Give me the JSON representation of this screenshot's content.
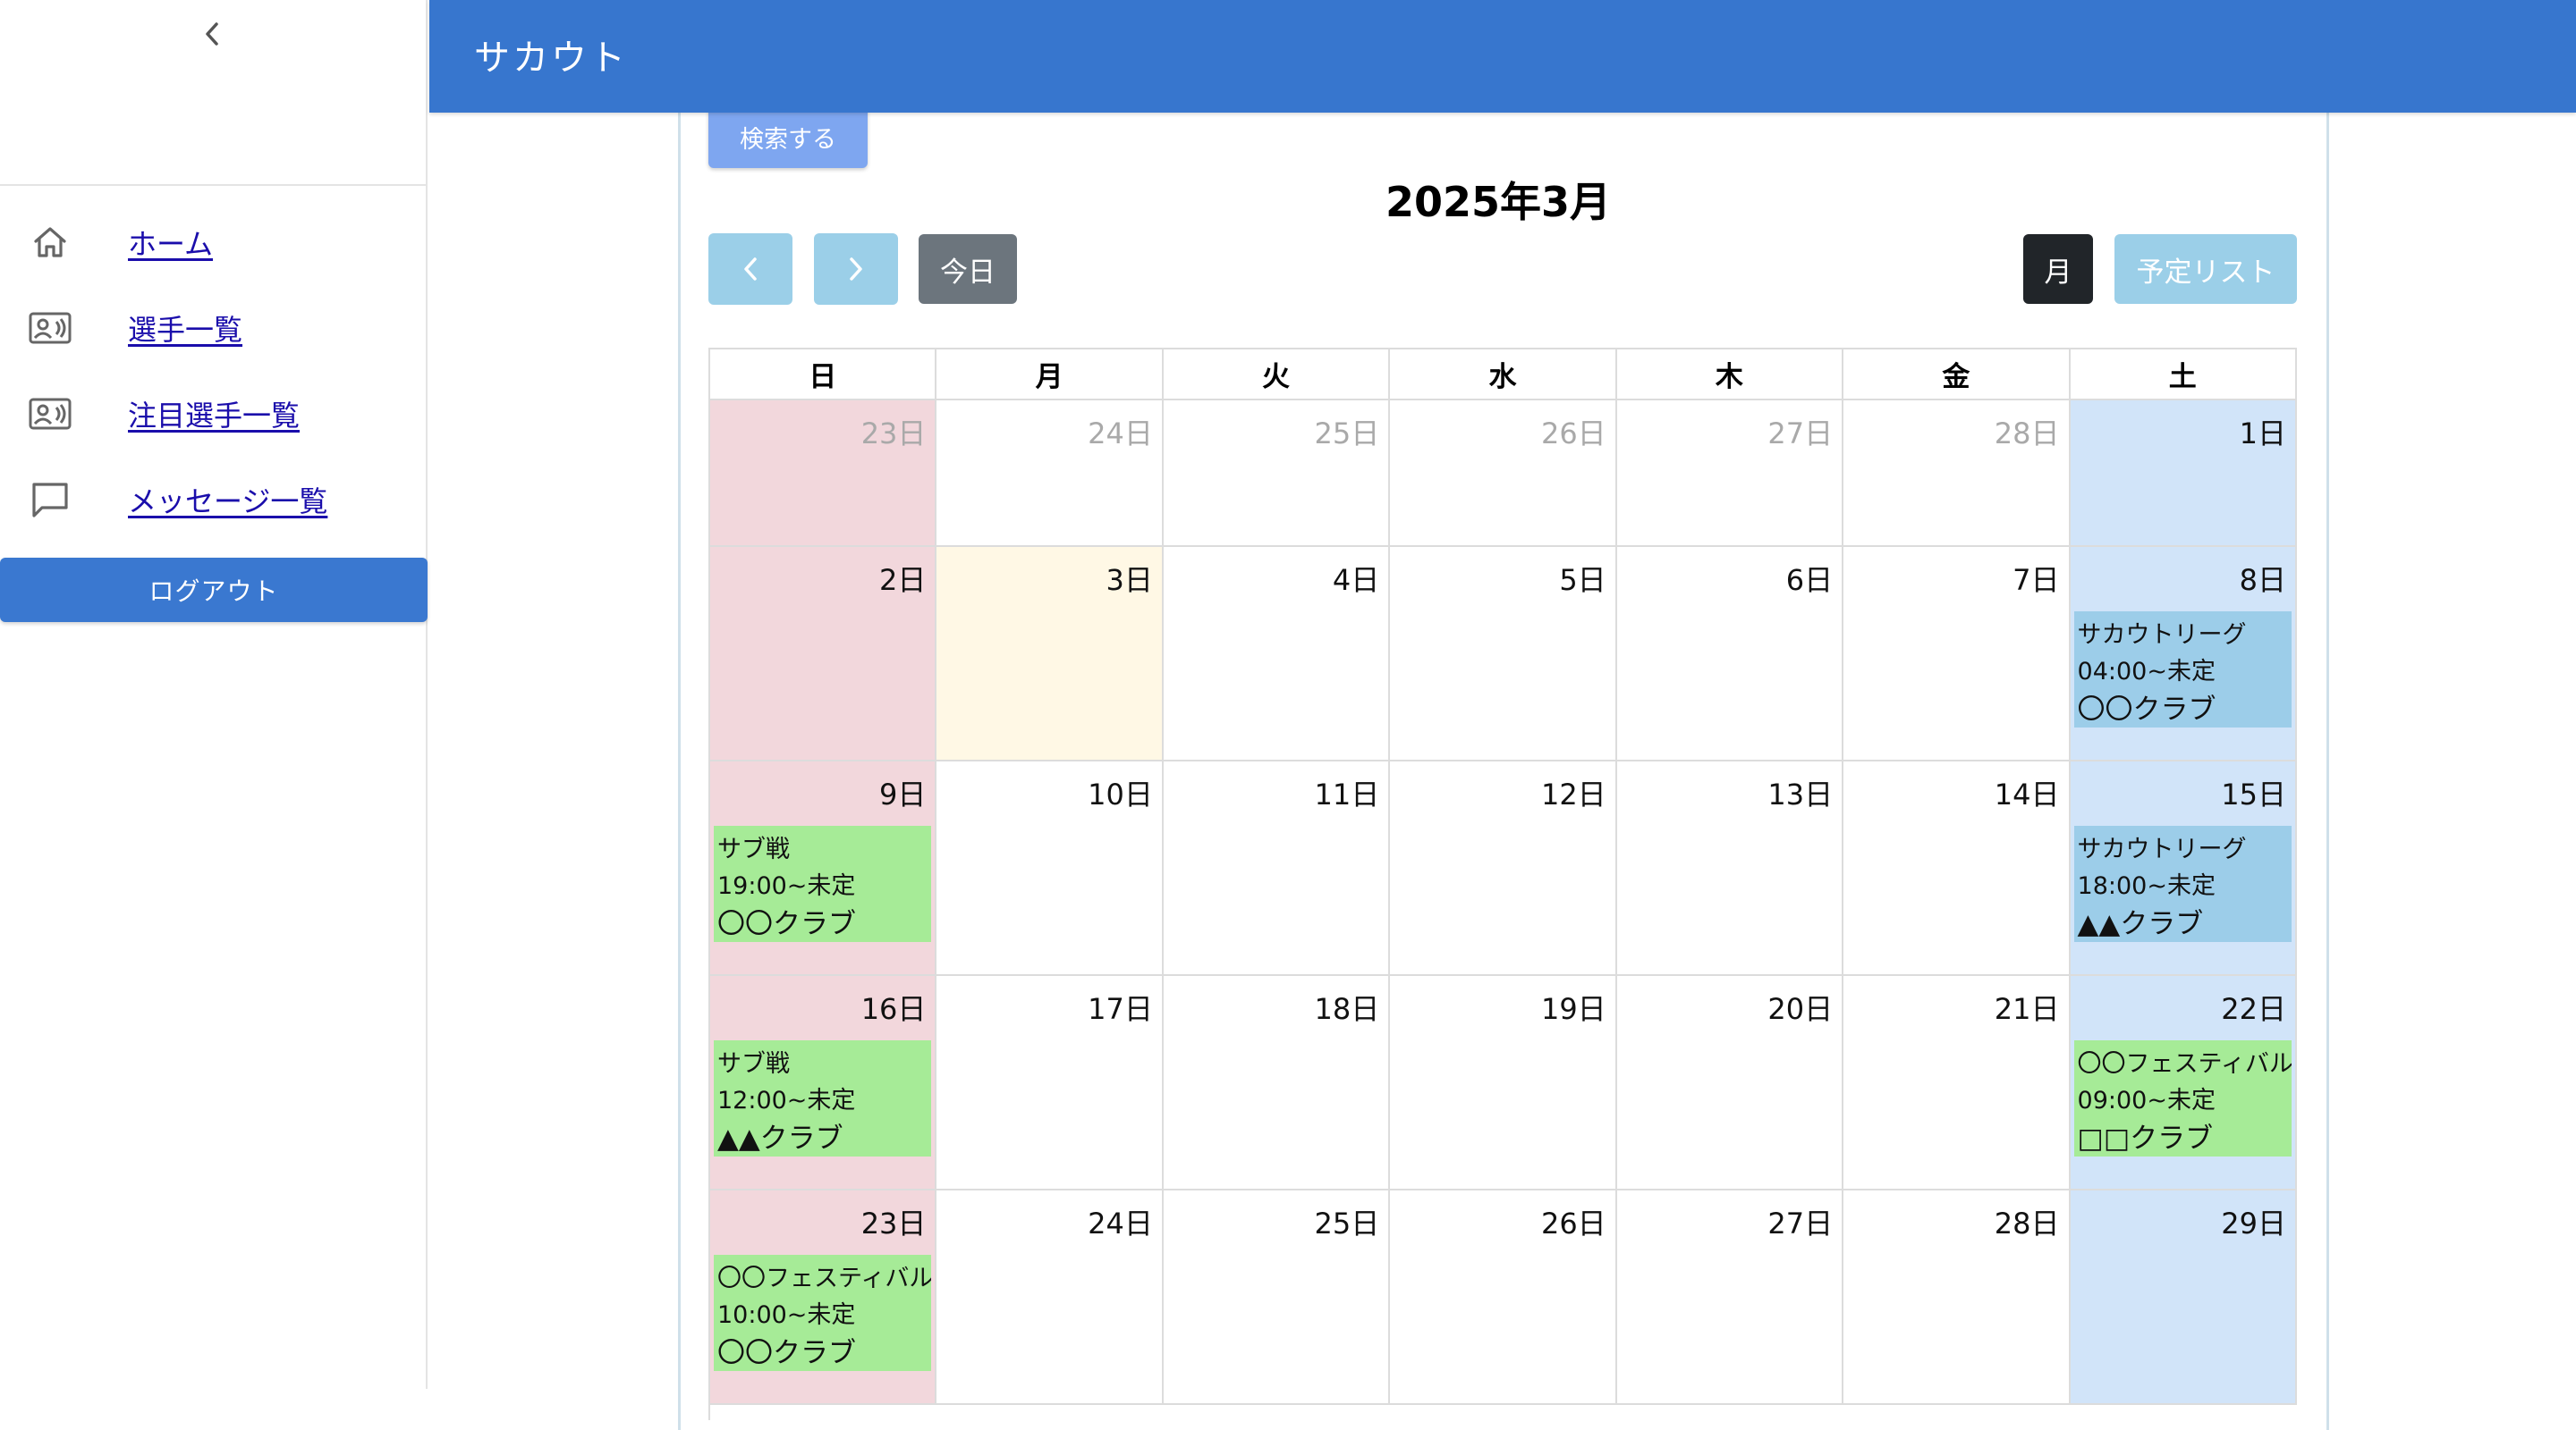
{
  "app": {
    "title": "サカウト"
  },
  "sidebar": {
    "items": [
      {
        "label": "ホーム",
        "icon": "home-icon"
      },
      {
        "label": "選手一覧",
        "icon": "contact-card-icon"
      },
      {
        "label": "注目選手一覧",
        "icon": "contact-card-icon"
      },
      {
        "label": "メッセージ一覧",
        "icon": "message-icon"
      }
    ],
    "logout_label": "ログアウト"
  },
  "search": {
    "button_label": "検索する"
  },
  "calendar": {
    "title": "2025年3月",
    "today_label": "今日",
    "month_view_label": "月",
    "list_view_label": "予定リスト",
    "weekdays": [
      "日",
      "月",
      "火",
      "水",
      "木",
      "金",
      "土"
    ],
    "weeks": [
      {
        "days": [
          {
            "label": "23日",
            "other": true
          },
          {
            "label": "24日",
            "other": true
          },
          {
            "label": "25日",
            "other": true
          },
          {
            "label": "26日",
            "other": true
          },
          {
            "label": "27日",
            "other": true
          },
          {
            "label": "28日",
            "other": true
          },
          {
            "label": "1日"
          }
        ]
      },
      {
        "days": [
          {
            "label": "2日"
          },
          {
            "label": "3日",
            "today": true
          },
          {
            "label": "4日"
          },
          {
            "label": "5日"
          },
          {
            "label": "6日"
          },
          {
            "label": "7日"
          },
          {
            "label": "8日",
            "event": {
              "title": "サカウトリーグ",
              "time": "04:00~未定",
              "club": "〇〇クラブ",
              "color": "blue"
            }
          }
        ]
      },
      {
        "days": [
          {
            "label": "9日",
            "event": {
              "title": "サブ戦",
              "time": "19:00~未定",
              "club": "〇〇クラブ",
              "color": "green"
            }
          },
          {
            "label": "10日"
          },
          {
            "label": "11日"
          },
          {
            "label": "12日"
          },
          {
            "label": "13日"
          },
          {
            "label": "14日"
          },
          {
            "label": "15日",
            "event": {
              "title": "サカウトリーグ",
              "time": "18:00~未定",
              "club": "▲▲クラブ",
              "color": "blue"
            }
          }
        ]
      },
      {
        "days": [
          {
            "label": "16日",
            "event": {
              "title": "サブ戦",
              "time": "12:00~未定",
              "club": "▲▲クラブ",
              "color": "green"
            }
          },
          {
            "label": "17日"
          },
          {
            "label": "18日"
          },
          {
            "label": "19日"
          },
          {
            "label": "20日"
          },
          {
            "label": "21日"
          },
          {
            "label": "22日",
            "event": {
              "title": "〇〇フェスティバル",
              "time": "09:00~未定",
              "club": "□□クラブ",
              "color": "green"
            }
          }
        ]
      },
      {
        "days": [
          {
            "label": "23日",
            "event": {
              "title": "〇〇フェスティバル",
              "time": "10:00~未定",
              "club": "〇〇クラブ",
              "color": "green"
            }
          },
          {
            "label": "24日"
          },
          {
            "label": "25日"
          },
          {
            "label": "26日"
          },
          {
            "label": "27日"
          },
          {
            "label": "28日"
          },
          {
            "label": "29日"
          }
        ]
      }
    ]
  },
  "colors": {
    "header": "#3776ce",
    "logout": "#3a78d0",
    "sunday": "#f2d7dc",
    "saturday": "#d1e4f9",
    "today": "#fff8e5",
    "event_green": "#a6eb97",
    "event_blue": "#9ccde9"
  }
}
